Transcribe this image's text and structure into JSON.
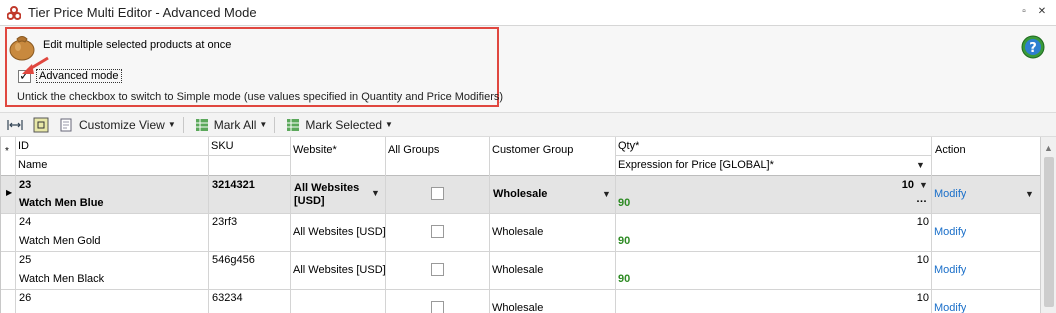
{
  "window": {
    "title": "Tier Price Multi Editor - Advanced Mode"
  },
  "info": {
    "title": "Edit multiple selected products at once",
    "advanced_label": "Advanced mode",
    "advanced_checked": true,
    "hint": "Untick the checkbox to switch to Simple mode (use values specified in Quantity and Price Modifiers)"
  },
  "toolbar": {
    "customize_view": "Customize View",
    "mark_all": "Mark All",
    "mark_selected": "Mark Selected"
  },
  "grid": {
    "headers": {
      "id": "ID",
      "name": "Name",
      "sku": "SKU",
      "website": "Website*",
      "all_groups": "All Groups",
      "customer_group": "Customer Group",
      "qty": "Qty*",
      "expression": "Expression for Price [GLOBAL]*",
      "action": "Action"
    },
    "rows": [
      {
        "id": "23",
        "name": "Watch Men Blue",
        "sku": "3214321",
        "website": "All Websites [USD]",
        "group": "Wholesale",
        "qty": "10",
        "price": "90",
        "action": "Modify"
      },
      {
        "id": "24",
        "name": "Watch Men Gold",
        "sku": "23rf3",
        "website": "All Websites [USD]",
        "group": "Wholesale",
        "qty": "10",
        "price": "90",
        "action": "Modify"
      },
      {
        "id": "25",
        "name": "Watch Men Black",
        "sku": "546g456",
        "website": "All Websites [USD]",
        "group": "Wholesale",
        "qty": "10",
        "price": "90",
        "action": "Modify"
      },
      {
        "id": "26",
        "name": "",
        "sku": "63234",
        "website": "",
        "group": "Wholesale",
        "qty": "10",
        "price": "",
        "action": "Modify"
      }
    ]
  }
}
